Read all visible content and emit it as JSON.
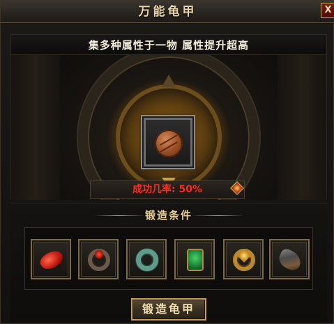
{
  "window": {
    "title": "万能龟甲",
    "close_label": "X"
  },
  "banner": {
    "text": "集多种属性于一物 属性提升超高"
  },
  "forge": {
    "center_item_icon": "tortoise-shell-armor-icon",
    "success_rate_label": "成功几率: 50%",
    "success_rate": 0.5
  },
  "materials": {
    "section_title": "锻造条件",
    "items": [
      {
        "icon": "red-necklace-icon"
      },
      {
        "icon": "ruby-ring-icon"
      },
      {
        "icon": "jade-ring-icon"
      },
      {
        "icon": "jade-amulet-icon"
      },
      {
        "icon": "gold-ring-icon"
      },
      {
        "icon": "bracer-icon"
      }
    ]
  },
  "actions": {
    "forge_button": "锻造龟甲"
  },
  "colors": {
    "title_gold": "#e9d6a8",
    "rate_red": "#ff2a1e",
    "frame_gold": "#c9a14c"
  }
}
